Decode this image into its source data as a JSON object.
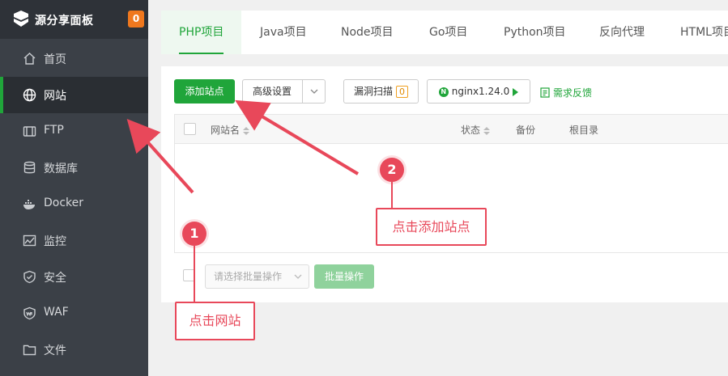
{
  "brand": {
    "title": "源分享面板",
    "badge": "0"
  },
  "sidebar": {
    "items": [
      {
        "label": "首页",
        "icon": "home-icon"
      },
      {
        "label": "网站",
        "icon": "globe-icon",
        "active": true
      },
      {
        "label": "FTP",
        "icon": "ftp-icon"
      },
      {
        "label": "数据库",
        "icon": "database-icon"
      },
      {
        "label": "Docker",
        "icon": "docker-icon"
      },
      {
        "label": "监控",
        "icon": "monitor-icon"
      },
      {
        "label": "安全",
        "icon": "shield-icon"
      },
      {
        "label": "WAF",
        "icon": "waf-shield-icon"
      },
      {
        "label": "文件",
        "icon": "folder-icon"
      }
    ]
  },
  "tabs": [
    "PHP项目",
    "Java项目",
    "Node项目",
    "Go项目",
    "Python项目",
    "反向代理",
    "HTML项目"
  ],
  "toolbar": {
    "add_site": "添加站点",
    "advanced": "高级设置",
    "scan": "漏洞扫描",
    "scan_count": "0",
    "nginx": "nginx1.24.0",
    "feedback": "需求反馈"
  },
  "table": {
    "columns": [
      "网站名",
      "状态",
      "备份",
      "根目录"
    ]
  },
  "batch": {
    "placeholder": "请选择批量操作",
    "button": "批量操作"
  },
  "annotations": {
    "step1": {
      "number": "1",
      "text": "点击网站"
    },
    "step2": {
      "number": "2",
      "text": "点击添加站点"
    }
  },
  "colors": {
    "accent": "#20a53a",
    "annotation": "#e8485a",
    "sidebar_bg": "#3b4047",
    "badge": "#f0781e"
  }
}
